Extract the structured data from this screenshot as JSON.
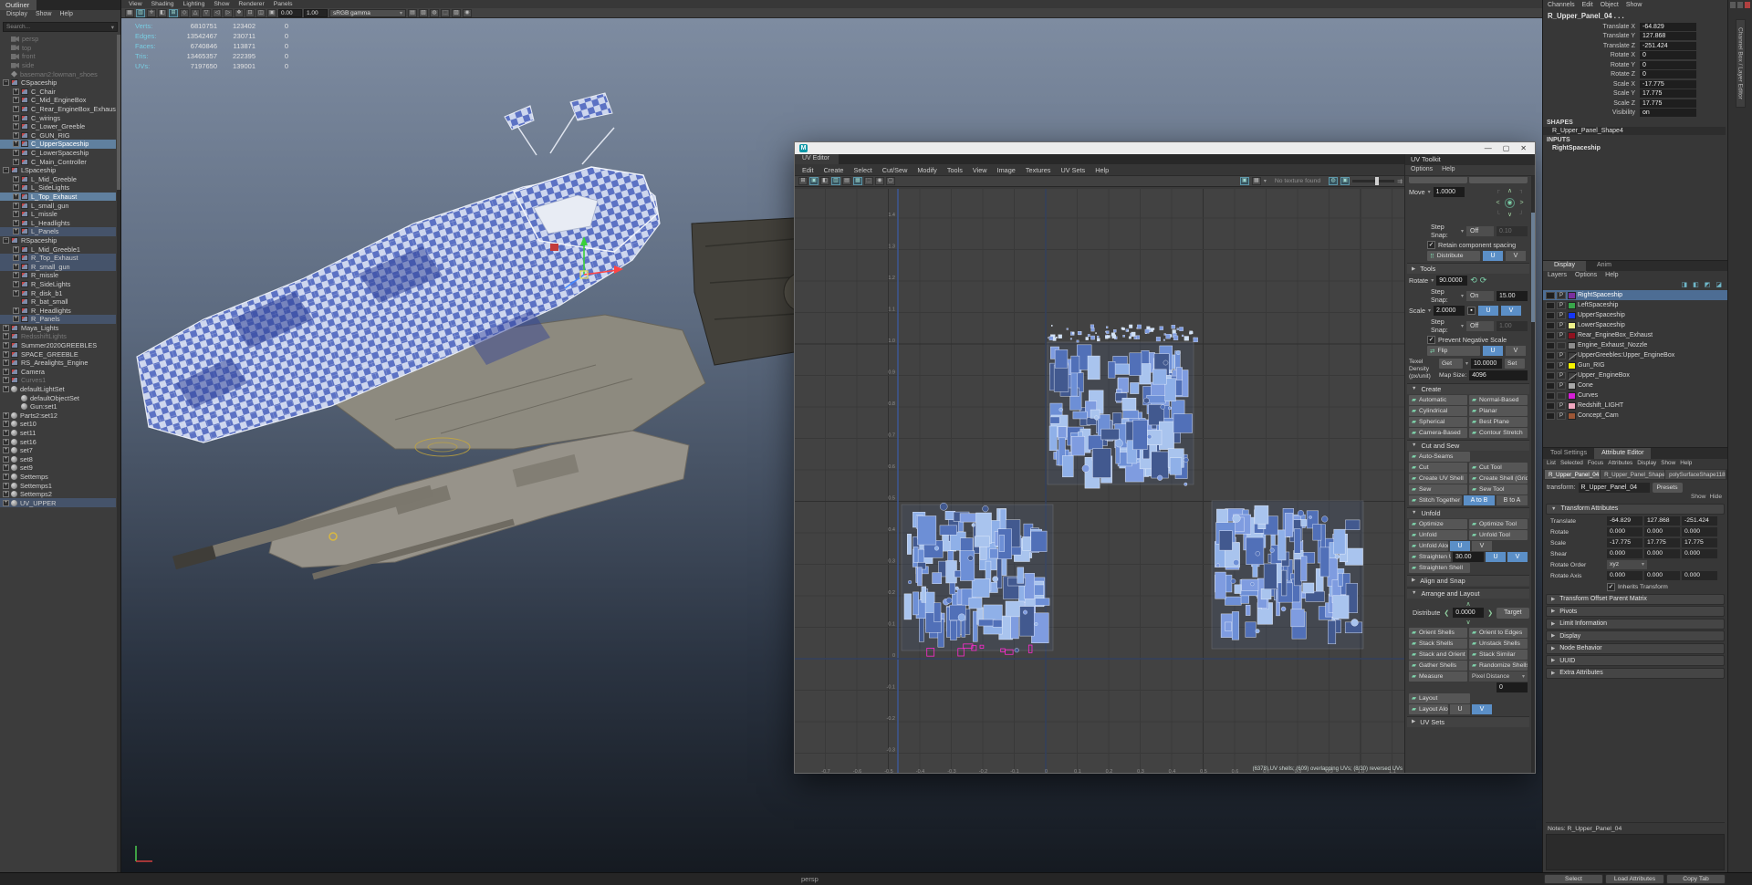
{
  "outliner": {
    "title": "Outliner",
    "menus": [
      "Display",
      "Show",
      "Help"
    ],
    "search": "Search...",
    "items": [
      {
        "l": "persp",
        "d": 1,
        "i": "cam",
        "s": "gray"
      },
      {
        "l": "top",
        "d": 1,
        "i": "cam",
        "s": "gray"
      },
      {
        "l": "front",
        "d": 1,
        "i": "cam",
        "s": "gray"
      },
      {
        "l": "side",
        "d": 1,
        "i": "cam",
        "s": "gray"
      },
      {
        "l": "baseman2:lowman_shoes",
        "d": 1,
        "i": "misc",
        "s": "gray"
      },
      {
        "l": "CSpaceship",
        "d": 1,
        "i": "mesh",
        "e": "-"
      },
      {
        "l": "C_Chair",
        "d": 2,
        "i": "mesh",
        "e": "+"
      },
      {
        "l": "C_Mid_EngineBox",
        "d": 2,
        "i": "mesh",
        "e": "+"
      },
      {
        "l": "C_Rear_EngineBox_Exhaust",
        "d": 2,
        "i": "mesh",
        "e": "+"
      },
      {
        "l": "C_wirings",
        "d": 2,
        "i": "mesh",
        "e": "+"
      },
      {
        "l": "C_Lower_Greeble",
        "d": 2,
        "i": "mesh",
        "e": "+"
      },
      {
        "l": "C_GUN_RIG",
        "d": 2,
        "i": "mesh",
        "e": "+"
      },
      {
        "l": "C_UpperSpaceship",
        "d": 2,
        "i": "mesh",
        "e": "+",
        "s": "sel"
      },
      {
        "l": "C_LowerSpaceship",
        "d": 2,
        "i": "mesh",
        "e": "+"
      },
      {
        "l": "C_Main_Controller",
        "d": 2,
        "i": "mesh",
        "e": "+"
      },
      {
        "l": "LSpaceship",
        "d": 1,
        "i": "mesh",
        "e": "-"
      },
      {
        "l": "L_Mid_Greeble",
        "d": 2,
        "i": "mesh",
        "e": "+"
      },
      {
        "l": "L_SideLights",
        "d": 2,
        "i": "mesh",
        "e": "+"
      },
      {
        "l": "L_Top_Exhaust",
        "d": 2,
        "i": "mesh",
        "e": "+",
        "s": "sel"
      },
      {
        "l": "L_small_gun",
        "d": 2,
        "i": "mesh",
        "e": "+"
      },
      {
        "l": "L_missle",
        "d": 2,
        "i": "mesh",
        "e": "+"
      },
      {
        "l": "L_Headlights",
        "d": 2,
        "i": "mesh",
        "e": "+"
      },
      {
        "l": "L_Panels",
        "d": 2,
        "i": "mesh",
        "e": "+",
        "s": "dim"
      },
      {
        "l": "RSpaceship",
        "d": 1,
        "i": "mesh",
        "e": "-"
      },
      {
        "l": "L_Mid_Greeble1",
        "d": 2,
        "i": "mesh",
        "e": "+"
      },
      {
        "l": "R_Top_Exhaust",
        "d": 2,
        "i": "mesh",
        "e": "+",
        "s": "dim"
      },
      {
        "l": "R_small_gun",
        "d": 2,
        "i": "mesh",
        "e": "+",
        "s": "dim"
      },
      {
        "l": "R_missle",
        "d": 2,
        "i": "mesh",
        "e": "+"
      },
      {
        "l": "R_SideLights",
        "d": 2,
        "i": "mesh",
        "e": "+"
      },
      {
        "l": "R_disk_b1",
        "d": 2,
        "i": "mesh",
        "e": "+"
      },
      {
        "l": "R_bat_small",
        "d": 2,
        "i": "mesh"
      },
      {
        "l": "R_Headlights",
        "d": 2,
        "i": "mesh",
        "e": "+"
      },
      {
        "l": "R_Panels",
        "d": 2,
        "i": "mesh",
        "e": "+",
        "s": "dim"
      },
      {
        "l": "Maya_Lights",
        "d": 1,
        "i": "mesh",
        "e": "+"
      },
      {
        "l": "RedsshiftLights",
        "d": 1,
        "i": "mesh",
        "e": "+",
        "s": "gray"
      },
      {
        "l": "Summer2020GREEBLES",
        "d": 1,
        "i": "mesh",
        "e": "+"
      },
      {
        "l": "SPACE_GREEBLE",
        "d": 1,
        "i": "mesh",
        "e": "+"
      },
      {
        "l": "RS_Arealights_Engine",
        "d": 1,
        "i": "mesh",
        "e": "+"
      },
      {
        "l": "Camera",
        "d": 1,
        "i": "mesh",
        "e": "+"
      },
      {
        "l": "Curves1",
        "d": 1,
        "i": "mesh",
        "e": "+",
        "s": "gray"
      },
      {
        "l": "defaultLightSet",
        "d": 1,
        "i": "set",
        "e": "+"
      },
      {
        "l": "defaultObjectSet",
        "d": 2,
        "i": "set"
      },
      {
        "l": "Gun:set1",
        "d": 2,
        "i": "set"
      },
      {
        "l": "Parts2:set12",
        "d": 1,
        "i": "set",
        "e": "+"
      },
      {
        "l": "set10",
        "d": 1,
        "i": "set",
        "e": "+"
      },
      {
        "l": "set11",
        "d": 1,
        "i": "set",
        "e": "+"
      },
      {
        "l": "set16",
        "d": 1,
        "i": "set",
        "e": "+"
      },
      {
        "l": "set7",
        "d": 1,
        "i": "set",
        "e": "+"
      },
      {
        "l": "set8",
        "d": 1,
        "i": "set",
        "e": "+"
      },
      {
        "l": "set9",
        "d": 1,
        "i": "set",
        "e": "+"
      },
      {
        "l": "Settemps",
        "d": 1,
        "i": "set",
        "e": "+"
      },
      {
        "l": "Settemps1",
        "d": 1,
        "i": "set",
        "e": "+"
      },
      {
        "l": "Settemps2",
        "d": 1,
        "i": "set",
        "e": "+"
      },
      {
        "l": "UV_UPPER",
        "d": 1,
        "i": "set",
        "e": "+",
        "s": "dim"
      }
    ]
  },
  "viewport": {
    "menus": [
      "View",
      "Shading",
      "Lighting",
      "Show",
      "Renderer",
      "Panels"
    ],
    "fields": [
      "0.00",
      "1.00"
    ],
    "gamma": "sRGB gamma",
    "camera": "persp",
    "hud": {
      "rows": [
        {
          "label": "Verts:",
          "a": "6810751",
          "b": "123402",
          "c": "0"
        },
        {
          "label": "Edges:",
          "a": "13542467",
          "b": "230711",
          "c": "0"
        },
        {
          "label": "Faces:",
          "a": "6740846",
          "b": "113871",
          "c": "0"
        },
        {
          "label": "Tris:",
          "a": "13465357",
          "b": "222395",
          "c": "0"
        },
        {
          "label": "UVs:",
          "a": "7197650",
          "b": "139001",
          "c": "0"
        }
      ]
    }
  },
  "uv": {
    "tab": "UV Editor",
    "menus": [
      "Edit",
      "Create",
      "Select",
      "Cut/Sew",
      "Modify",
      "Tools",
      "View",
      "Image",
      "Textures",
      "UV Sets",
      "Help"
    ],
    "no_texture": "No texture found",
    "status": "(6378) UV shells; (609) overlapping UVs; (8/30) reversed UVs",
    "ruler_left": [
      "1.4",
      "1.3",
      "1.2",
      "1.1",
      "1.0",
      "0.9",
      "0.8",
      "0.7",
      "0.6",
      "0.5",
      "0.4",
      "0.3",
      "0.2",
      "0.1",
      "0",
      "-0.1",
      "-0.2",
      "-0.3"
    ],
    "ruler_bottom": [
      "-0.7",
      "-0.6",
      "-0.5",
      "-0.4",
      "-0.3",
      "-0.2",
      "-0.1",
      "0",
      "0.1",
      "0.2",
      "0.3",
      "0.4",
      "0.5",
      "0.6",
      "0.7",
      "0.8",
      "0.9",
      "1.0",
      "1.1"
    ],
    "toolkit": {
      "title": "UV Toolkit",
      "menus": [
        "Options",
        "Help"
      ],
      "move": {
        "label": "Move",
        "value": "1.0000"
      },
      "move_step": {
        "label": "Step Snap:",
        "state": "Off",
        "size": "0.10"
      },
      "retain": "Retain component spacing",
      "distribute": {
        "label": "Distribute",
        "u": "U",
        "v": "V"
      },
      "tools": "Tools",
      "rotate": {
        "label": "Rotate",
        "value": "90.0000"
      },
      "rotate_step": {
        "label": "Step Snap:",
        "state": "On",
        "size": "15.00"
      },
      "scale": {
        "label": "Scale",
        "value": "2.0000",
        "u": "U",
        "v": "V"
      },
      "scale_step": {
        "label": "Step Snap:",
        "state": "Off",
        "size": "1.00"
      },
      "prevent": "Prevent Negative Scale",
      "flip": {
        "label": "Flip",
        "u": "U",
        "v": "V"
      },
      "texel": {
        "l1": "Texel",
        "l2": "Density",
        "l3": "(px/unit)",
        "get": "Get",
        "value": "10.0000",
        "set": "Set"
      },
      "map": {
        "label": "Map Size:",
        "value": "4096"
      },
      "dist2": {
        "label": "Distribute",
        "value": "0.0000",
        "target": "Target"
      },
      "sections": [
        {
          "h": "Create",
          "rows": [
            [
              {
                "b": "Automatic"
              },
              {
                "b": "Normal-Based"
              }
            ],
            [
              {
                "b": "Cylindrical"
              },
              {
                "b": "Planar"
              }
            ],
            [
              {
                "b": "Spherical"
              },
              {
                "b": "Best Plane"
              }
            ],
            [
              {
                "b": "Camera-Based"
              },
              {
                "b": "Contour Stretch"
              }
            ]
          ]
        },
        {
          "h": "Cut and Sew",
          "rows": [
            [
              {
                "b": "Auto-Seams"
              },
              {
                "sp": 1
              }
            ],
            [
              {
                "b": "Cut"
              },
              {
                "b": "Cut Tool"
              }
            ],
            [
              {
                "b": "Create UV Shell"
              },
              {
                "b": "Create Shell (Grid)"
              }
            ],
            [
              {
                "b": "Sew"
              },
              {
                "b": "Sew Tool"
              }
            ],
            [
              {
                "b": "Stitch Together"
              },
              {
                "tg": "A to B",
                "on": true
              },
              {
                "tg": "B to A"
              }
            ]
          ]
        },
        {
          "h": "Unfold",
          "rows": [
            [
              {
                "b": "Optimize"
              },
              {
                "b": "Optimize Tool"
              }
            ],
            [
              {
                "b": "Unfold"
              },
              {
                "b": "Unfold Tool"
              }
            ],
            [
              {
                "b": "Unfold Along"
              },
              {
                "tg": "U",
                "on": true,
                "sq": 1
              },
              {
                "tg": "V",
                "sq": 1
              },
              {
                "sp": 1
              }
            ],
            [
              {
                "b": "Straighten UVs"
              },
              {
                "f": "30.00"
              },
              {
                "tg": "U",
                "on": true,
                "sq": 1
              },
              {
                "tg": "V",
                "on": true,
                "sq": 1
              }
            ],
            [
              {
                "b": "Straighten Shell"
              },
              {
                "sp": 1
              }
            ]
          ]
        },
        {
          "h": "Align and Snap",
          "collapsed": true
        },
        {
          "h": "Arrange and Layout",
          "widget": "distribute"
        },
        {
          "rows": [
            [
              {
                "b": "Orient Shells"
              },
              {
                "b": "Orient to Edges"
              }
            ],
            [
              {
                "b": "Stack Shells"
              },
              {
                "b": "Unstack Shells"
              }
            ],
            [
              {
                "b": "Stack and Orient"
              },
              {
                "b": "Stack Similar"
              }
            ],
            [
              {
                "b": "Gather Shells"
              },
              {
                "b": "Randomize Shells"
              }
            ],
            [
              {
                "b": "Measure"
              },
              {
                "dd": "Pixel Distance"
              }
            ],
            [
              {
                "sp": 1
              },
              {
                "f": "0"
              }
            ],
            [
              {
                "b": "Layout"
              },
              {
                "sp": 1
              }
            ],
            [
              {
                "b": "Layout Along"
              },
              {
                "tg": "U",
                "sq": 1
              },
              {
                "tg": "V",
                "on": true,
                "sq": 1
              },
              {
                "sp": 1
              }
            ]
          ]
        },
        {
          "h": "UV Sets",
          "collapsed": true
        }
      ]
    }
  },
  "channel_box": {
    "menus": [
      "Channels",
      "Edit",
      "Object",
      "Show"
    ],
    "node": "R_Upper_Panel_04 . . .",
    "rows": [
      {
        "label": "Translate X",
        "value": "-64.829"
      },
      {
        "label": "Translate Y",
        "value": "127.868"
      },
      {
        "label": "Translate Z",
        "value": "-251.424"
      },
      {
        "label": "Rotate X",
        "value": "0"
      },
      {
        "label": "Rotate Y",
        "value": "0"
      },
      {
        "label": "Rotate Z",
        "value": "0"
      },
      {
        "label": "Scale X",
        "value": "-17.775"
      },
      {
        "label": "Scale Y",
        "value": "17.775"
      },
      {
        "label": "Scale Z",
        "value": "17.775"
      },
      {
        "label": "Visibility",
        "value": "on"
      }
    ],
    "shapes_label": "SHAPES",
    "shape": "R_Upper_Panel_Shape4",
    "inputs_label": "INPUTS",
    "input": "RightSpaceship"
  },
  "layers": {
    "tabs": [
      "Display",
      "Anim"
    ],
    "menus": [
      "Layers",
      "Options",
      "Help"
    ],
    "rows": [
      {
        "name": "RightSpaceship",
        "color": "#7a2f9e",
        "p": true,
        "sel": true
      },
      {
        "name": "LeftSpaceship",
        "color": "#39a54a",
        "p": true
      },
      {
        "name": "UpperSpaceship",
        "color": "#1536f5",
        "p": true
      },
      {
        "name": "LowerSpaceship",
        "color": "#eef08b",
        "p": true
      },
      {
        "name": "Rear_EngineBox_Exhaust",
        "color": "#8f1220",
        "p": true
      },
      {
        "name": "Engine_Exhaust_Nozzle",
        "color": "#8c8c8c",
        "p": false
      },
      {
        "name": "UpperGreebles:Upper_EngineBox",
        "color": null,
        "p": true
      },
      {
        "name": "Gun_RIG",
        "color": "#f5f200",
        "p": true
      },
      {
        "name": "Upper_EngineBox",
        "color": null,
        "p": true
      },
      {
        "name": "Cone",
        "color": "#a8a8a8",
        "p": true
      },
      {
        "name": "Curves",
        "color": "#d51fd5",
        "p": false
      },
      {
        "name": "Redshift_LIGHT",
        "color": "#f0a7c0",
        "p": true
      },
      {
        "name": "Concept_Cam",
        "color": "#9c5636",
        "p": true
      }
    ]
  },
  "ae": {
    "tabs": [
      "Tool Settings",
      "Attribute Editor"
    ],
    "menus": [
      "List",
      "Selected",
      "Focus",
      "Attributes",
      "Display",
      "Show",
      "Help"
    ],
    "node_tabs": [
      "R_Upper_Panel_04",
      "R_Upper_Panel_Shape4",
      "polySurfaceShape118"
    ],
    "transform_label": "transform:",
    "node_field": "R_Upper_Panel_04",
    "presets": "Presets",
    "show": "Show",
    "hide": "Hide",
    "main_section": "Transform Attributes",
    "rows": [
      {
        "label": "Translate",
        "values": [
          "-64.829",
          "127.868",
          "-251.424"
        ]
      },
      {
        "label": "Rotate",
        "values": [
          "0.000",
          "0.000",
          "0.000"
        ]
      },
      {
        "label": "Scale",
        "values": [
          "-17.775",
          "17.775",
          "17.775"
        ]
      },
      {
        "label": "Shear",
        "values": [
          "0.000",
          "0.000",
          "0.000"
        ]
      }
    ],
    "rotate_order_label": "Rotate Order",
    "rotate_order": "xyz",
    "rotate_axis_label": "Rotate Axis",
    "rotate_axis": [
      "0.000",
      "0.000",
      "0.000"
    ],
    "inherits": "Inherits Transform",
    "collapsed_sections": [
      "Transform Offset Parent Matrix",
      "Pivots",
      "Limit Information",
      "Display",
      "Node Behavior",
      "UUID",
      "Extra Attributes"
    ],
    "notes": "Notes: R_Upper_Panel_04",
    "footer": [
      "Select",
      "Load Attributes",
      "Copy Tab"
    ]
  },
  "side_tab": "Channel Box / Layer Editor"
}
